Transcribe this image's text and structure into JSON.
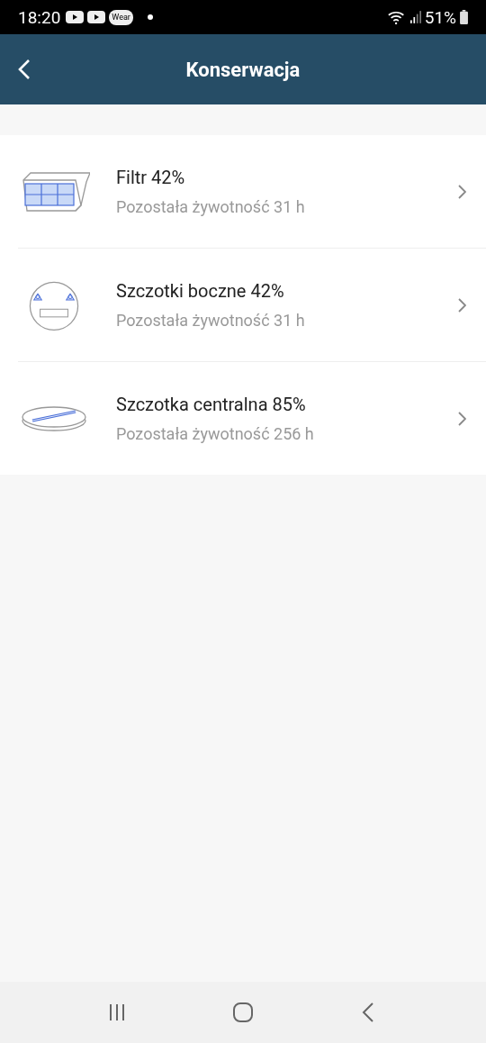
{
  "status_bar": {
    "time": "18:20",
    "app_badge": "Wear",
    "battery": "51%"
  },
  "header": {
    "title": "Konserwacja"
  },
  "items": [
    {
      "kind": "filter",
      "title": "Filtr 42%",
      "subtitle": "Pozostała żywotność 31 h"
    },
    {
      "kind": "side-brush",
      "title": "Szczotki boczne 42%",
      "subtitle": "Pozostała żywotność 31 h"
    },
    {
      "kind": "main-brush",
      "title": "Szczotka centralna 85%",
      "subtitle": "Pozostała żywotność 256 h"
    }
  ]
}
